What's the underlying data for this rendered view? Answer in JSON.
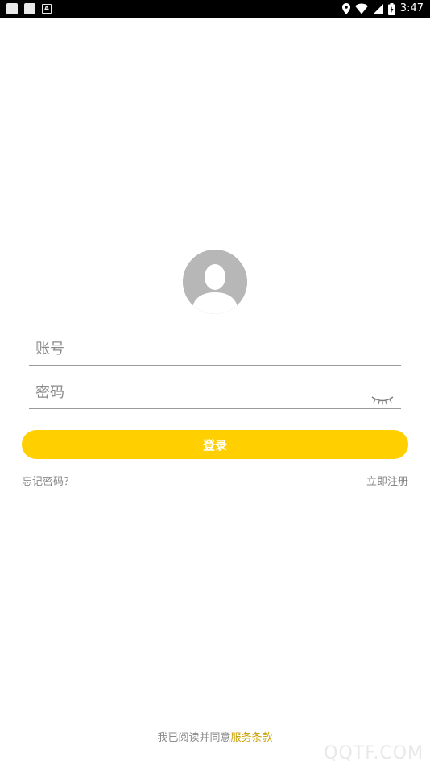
{
  "status_bar": {
    "time": "3:47",
    "notification_badge": "A",
    "icons": [
      "square-icon",
      "square-icon",
      "a-icon",
      "location-icon",
      "wifi-icon",
      "signal-icon",
      "battery-icon"
    ]
  },
  "login": {
    "account_placeholder": "账号",
    "password_placeholder": "密码",
    "login_label": "登录",
    "forgot_label": "忘记密码？",
    "register_label": "立即注册"
  },
  "terms": {
    "prefix": "我已阅读并同意",
    "link": "服务条款"
  },
  "watermark": "QQTF.COM",
  "colors": {
    "accent": "#ffcf00",
    "terms_link": "#c9a100",
    "muted_text": "#8a8a8a",
    "avatar_bg": "#b7b7b7"
  }
}
